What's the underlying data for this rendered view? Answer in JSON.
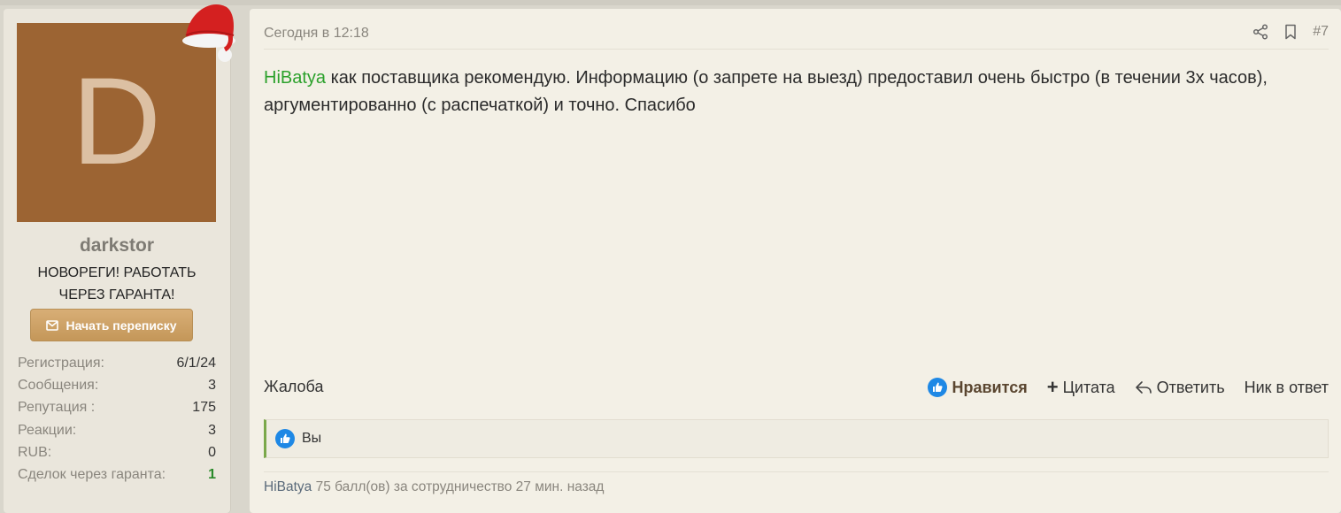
{
  "user": {
    "avatar_letter": "D",
    "name": "darkstor",
    "title_line1": "НОВОРЕГИ! РАБОТАТЬ",
    "title_line2": "ЧЕРЕЗ ГАРАНТА!",
    "message_button": "Начать переписку",
    "stats": [
      {
        "label": "Регистрация:",
        "value": "6/1/24"
      },
      {
        "label": "Сообщения:",
        "value": "3"
      },
      {
        "label": "Репутация :",
        "value": "175"
      },
      {
        "label": "Реакции:",
        "value": "3"
      },
      {
        "label": "RUB:",
        "value": "0"
      },
      {
        "label": "Сделок через гаранта:",
        "value": "1"
      }
    ]
  },
  "post": {
    "date": "Сегодня в 12:18",
    "number": "#7",
    "mention": "HiBatya",
    "text": " как поставщика рекомендую. Информацию (о запрете на выезд) предоставил очень быстро (в течении 3х часов), аргументированно (с распечаткой) и точно. Спасибо",
    "report": "Жалоба",
    "like": "Нравится",
    "quote": "Цитата",
    "reply": "Ответить",
    "nick_reply": "Ник в ответ",
    "reactions_text": "Вы",
    "rep_user": "HiBatya",
    "rep_text": " 75 балл(ов) за сотрудничество 27 мин. назад"
  },
  "colors": {
    "avatar_bg": "#9c6433",
    "mention": "#2ca12c",
    "like_blue": "#1e88e5",
    "deal_green": "#2a8a2a"
  }
}
